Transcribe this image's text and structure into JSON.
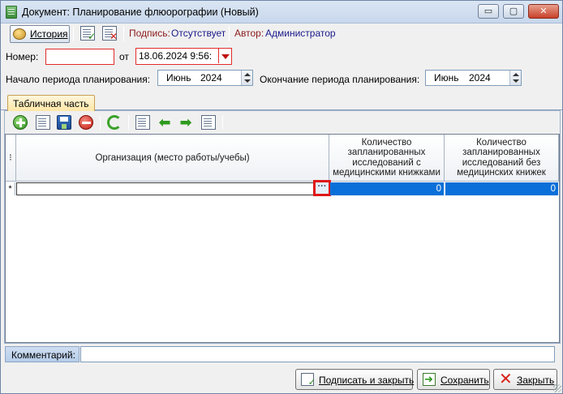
{
  "window": {
    "title": "Документ: Планирование флюорографии (Новый)",
    "min_glyph": "▭",
    "max_glyph": "▢",
    "close_glyph": "✕"
  },
  "toolbar": {
    "history_label": "История",
    "sign_label": "Подпись:",
    "sign_value": "Отсутствует",
    "author_label": "Автор:",
    "author_value": "Администратор"
  },
  "header": {
    "number_label": "Номер:",
    "number_value": "",
    "date_from_label": "от",
    "date_value": "18.06.2024 9:56:",
    "period_start_label": "Начало периода планирования:",
    "period_start_month": "Июнь",
    "period_start_year": "2024",
    "period_end_label": "Окончание периода планирования:",
    "period_end_month": "Июнь",
    "period_end_year": "2024"
  },
  "tabs": [
    {
      "label": "Табличная часть",
      "active": true
    }
  ],
  "grid": {
    "columns": [
      "Организация (место работы/учебы)",
      "Количество запланированных исследований с медицинскими книжками",
      "Количество запланированных исследований без медицинских книжек"
    ],
    "rows": [
      {
        "indicator": "*",
        "organization": "",
        "with_books": "0",
        "without_books": "0"
      }
    ],
    "ellipsis": "···",
    "header_indicator": "⁝"
  },
  "footer": {
    "comment_label": "Комментарий:",
    "comment_value": "",
    "sign_close_label": "Подписать и закрыть",
    "save_label": "Сохранить",
    "close_label": "Закрыть"
  },
  "colors": {
    "selection": "#0a6fd8",
    "error_border": "#e32b2b",
    "tab_active": "#ffe7a6"
  }
}
